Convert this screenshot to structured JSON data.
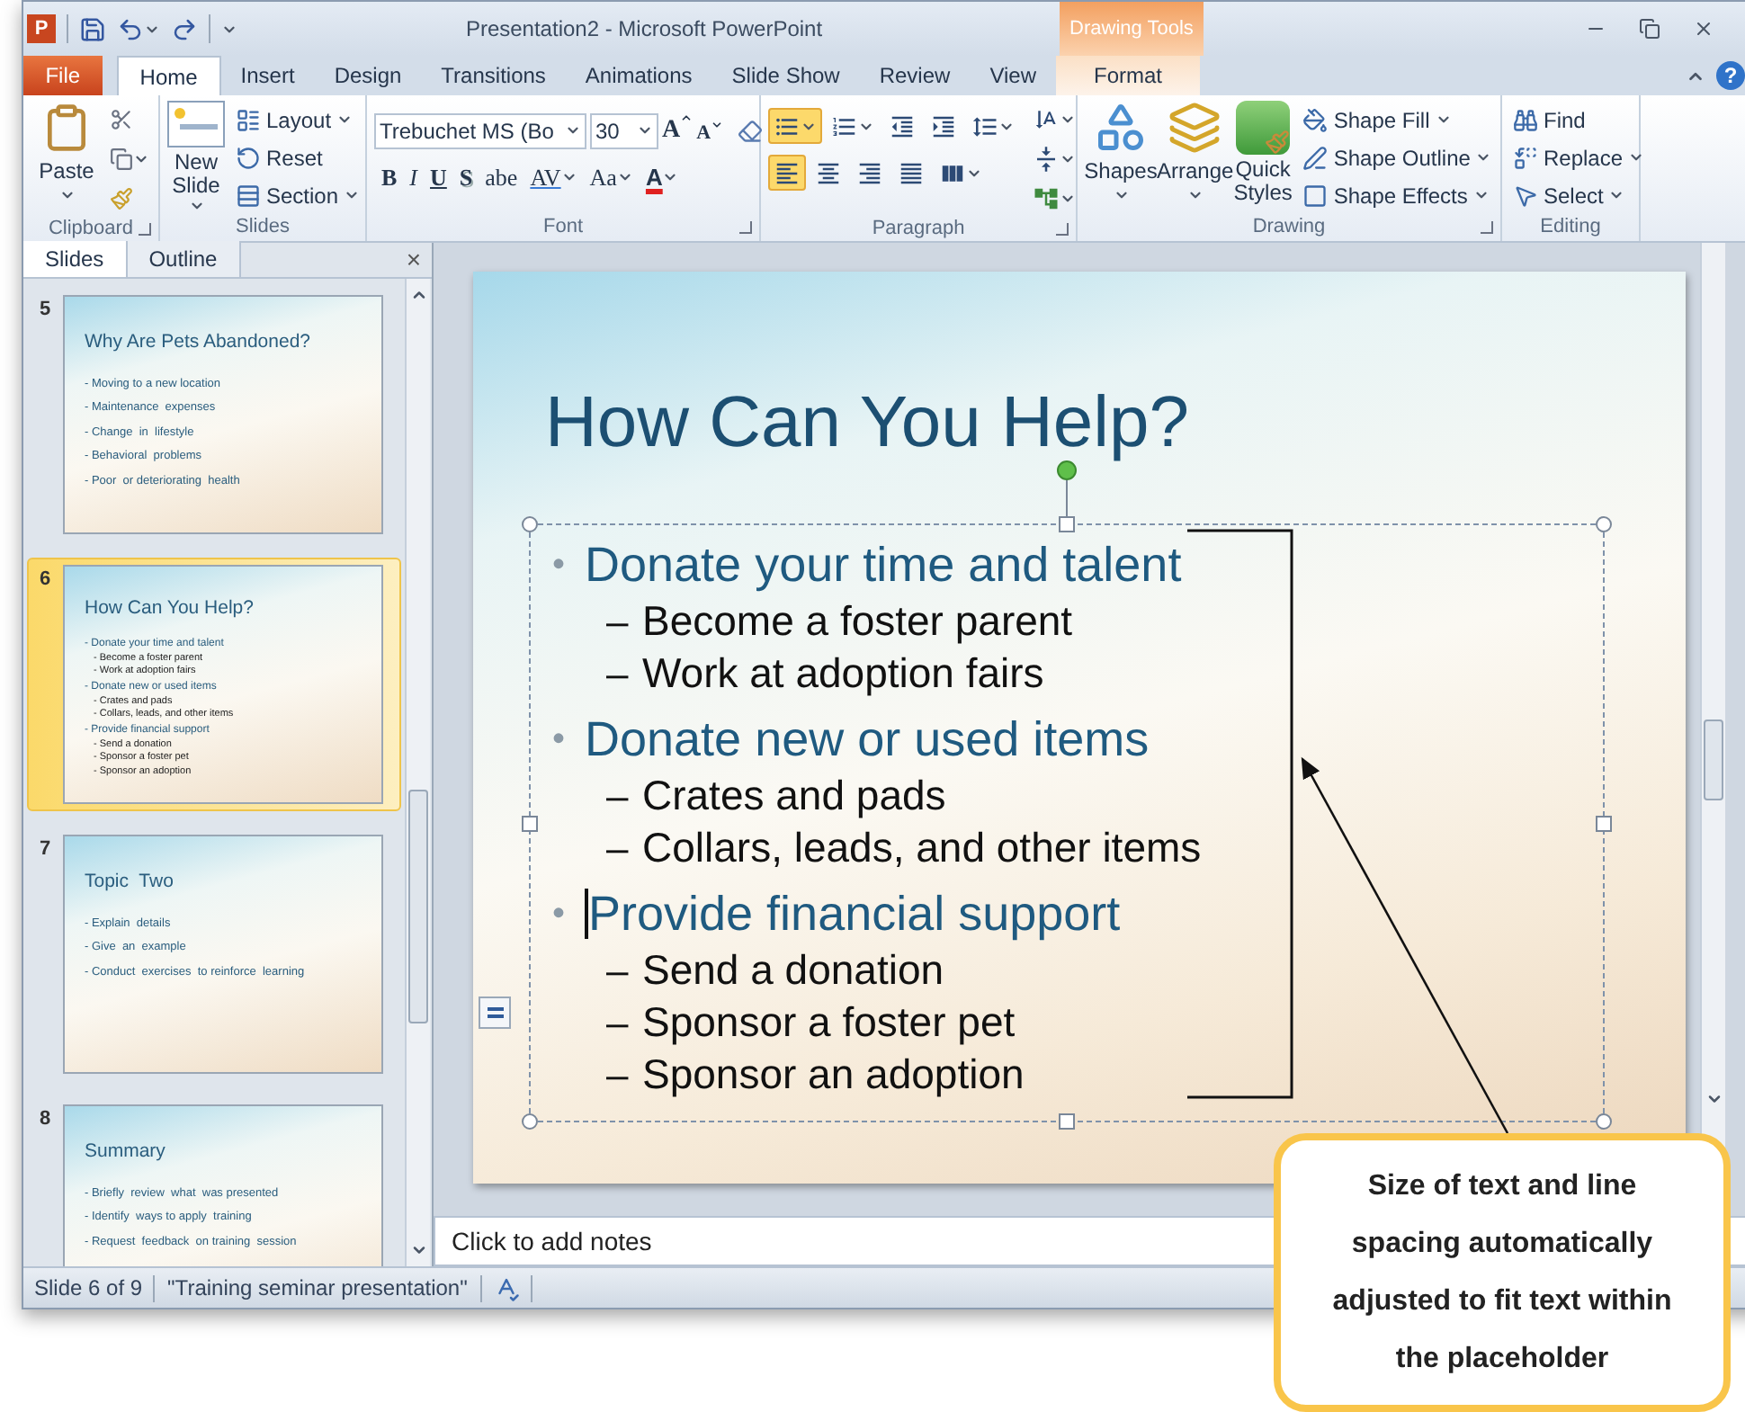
{
  "window": {
    "app_letter": "P",
    "title": "Presentation2 - Microsoft PowerPoint",
    "context_header": "Drawing Tools",
    "help": "?"
  },
  "tabs": [
    {
      "label": "File",
      "kind": "file",
      "selected": false
    },
    {
      "label": "Home",
      "kind": "tab",
      "selected": true
    },
    {
      "label": "Insert",
      "kind": "tab",
      "selected": false
    },
    {
      "label": "Design",
      "kind": "tab",
      "selected": false
    },
    {
      "label": "Transitions",
      "kind": "tab",
      "selected": false
    },
    {
      "label": "Animations",
      "kind": "tab",
      "selected": false
    },
    {
      "label": "Slide Show",
      "kind": "tab",
      "selected": false
    },
    {
      "label": "Review",
      "kind": "tab",
      "selected": false
    },
    {
      "label": "View",
      "kind": "tab",
      "selected": false
    },
    {
      "label": "Format",
      "kind": "contextual",
      "selected": false
    }
  ],
  "ribbon": {
    "clipboard": {
      "label": "Clipboard",
      "paste": "Paste"
    },
    "slides": {
      "label": "Slides",
      "new_slide": "New Slide",
      "items": [
        {
          "label": "Layout",
          "dropdown": true
        },
        {
          "label": "Reset",
          "dropdown": false
        },
        {
          "label": "Section",
          "dropdown": true
        }
      ]
    },
    "font": {
      "label": "Font",
      "name": "Trebuchet MS (Bo",
      "size": "30",
      "grow": "A",
      "shrink": "A",
      "format_buttons": [
        {
          "label": "B",
          "kind": "bold",
          "dropdown": false
        },
        {
          "label": "I",
          "kind": "italic",
          "dropdown": false
        },
        {
          "label": "U",
          "kind": "underline",
          "dropdown": false
        },
        {
          "label": "S",
          "kind": "shadow",
          "dropdown": false
        },
        {
          "label": "abe",
          "kind": "strike",
          "dropdown": false
        },
        {
          "label": "AV",
          "kind": "spacing",
          "dropdown": true
        },
        {
          "label": "Aa",
          "kind": "case",
          "dropdown": true
        },
        {
          "label": "A",
          "kind": "color",
          "dropdown": true
        }
      ]
    },
    "paragraph": {
      "label": "Paragraph",
      "bullets": {
        "selected": true
      },
      "numbering": {
        "selected": false
      },
      "alignment": [
        {
          "selected": true
        },
        {
          "selected": false
        },
        {
          "selected": false
        },
        {
          "selected": false
        }
      ]
    },
    "drawing": {
      "label": "Drawing",
      "shapes": "Shapes",
      "arrange": "Arrange",
      "quick_styles": "Quick Styles",
      "items": [
        {
          "label": "Shape Fill",
          "dropdown": true
        },
        {
          "label": "Shape Outline",
          "dropdown": true
        },
        {
          "label": "Shape Effects",
          "dropdown": true
        }
      ]
    },
    "editing": {
      "label": "Editing",
      "items": [
        {
          "label": "Find",
          "dropdown": false
        },
        {
          "label": "Replace",
          "dropdown": true
        },
        {
          "label": "Select",
          "dropdown": true
        }
      ]
    }
  },
  "pane": {
    "tabs": [
      {
        "label": "Slides",
        "selected": true
      },
      {
        "label": "Outline",
        "selected": false
      }
    ],
    "close": "×",
    "slides": [
      {
        "number": "5",
        "selected": false,
        "title": "Why Are Pets Abandoned?",
        "bullets": [
          {
            "marker": "-",
            "text": "Moving to a new location"
          },
          {
            "marker": "-",
            "text": "Maintenance  expenses"
          },
          {
            "marker": "-",
            "text": "Change  in  lifestyle"
          },
          {
            "marker": "-",
            "text": "Behavioral  problems"
          },
          {
            "marker": "-",
            "text": "Poor  or deteriorating  health"
          }
        ]
      },
      {
        "number": "6",
        "selected": true,
        "title": "How Can You Help?",
        "bullets": [
          {
            "marker": "-",
            "text": "Donate your time and talent",
            "children": [
              {
                "marker": "-",
                "text": "Become a foster parent"
              },
              {
                "marker": "-",
                "text": "Work at adoption fairs"
              }
            ]
          },
          {
            "marker": "-",
            "text": "Donate new or used items",
            "children": [
              {
                "marker": "-",
                "text": "Crates and pads"
              },
              {
                "marker": "-",
                "text": "Collars, leads, and other items"
              }
            ]
          },
          {
            "marker": "-",
            "text": "Provide financial support",
            "children": [
              {
                "marker": "-",
                "text": "Send a donation"
              },
              {
                "marker": "-",
                "text": "Sponsor a foster pet"
              },
              {
                "marker": "-",
                "text": "Sponsor an adoption"
              }
            ]
          }
        ]
      },
      {
        "number": "7",
        "selected": false,
        "title": "Topic  Two",
        "bullets": [
          {
            "marker": "-",
            "text": "Explain  details"
          },
          {
            "marker": "-",
            "text": "Give  an  example"
          },
          {
            "marker": "-",
            "text": "Conduct  exercises  to reinforce  learning"
          }
        ]
      },
      {
        "number": "8",
        "selected": false,
        "title": "Summary",
        "bullets": [
          {
            "marker": "-",
            "text": "Briefly  review  what  was presented"
          },
          {
            "marker": "-",
            "text": "Identify  ways to apply  training"
          },
          {
            "marker": "-",
            "text": "Request  feedback  on training  session"
          }
        ]
      }
    ]
  },
  "slide": {
    "title": "How Can You Help?",
    "bullets": [
      {
        "marker": "•",
        "text": "Donate your time and talent",
        "cursor": false,
        "children": [
          {
            "marker": "–",
            "text": "Become a foster parent"
          },
          {
            "marker": "–",
            "text": "Work at adoption fairs"
          }
        ]
      },
      {
        "marker": "•",
        "text": "Donate new or used items",
        "cursor": false,
        "children": [
          {
            "marker": "–",
            "text": "Crates and pads"
          },
          {
            "marker": "–",
            "text": "Collars, leads, and other items"
          }
        ]
      },
      {
        "marker": "•",
        "text": "Provide financial support",
        "cursor": true,
        "children": [
          {
            "marker": "–",
            "text": "Send a donation"
          },
          {
            "marker": "–",
            "text": "Sponsor a foster pet"
          },
          {
            "marker": "–",
            "text": "Sponsor an adoption"
          }
        ]
      }
    ]
  },
  "notes": {
    "prompt": "Click to add notes"
  },
  "status_bar": {
    "slide_position": "Slide 6 of 9",
    "theme": "\"Training seminar presentation\""
  },
  "callout": {
    "text": "Size of text and line spacing automatically adjusted to fit text within the placeholder"
  }
}
